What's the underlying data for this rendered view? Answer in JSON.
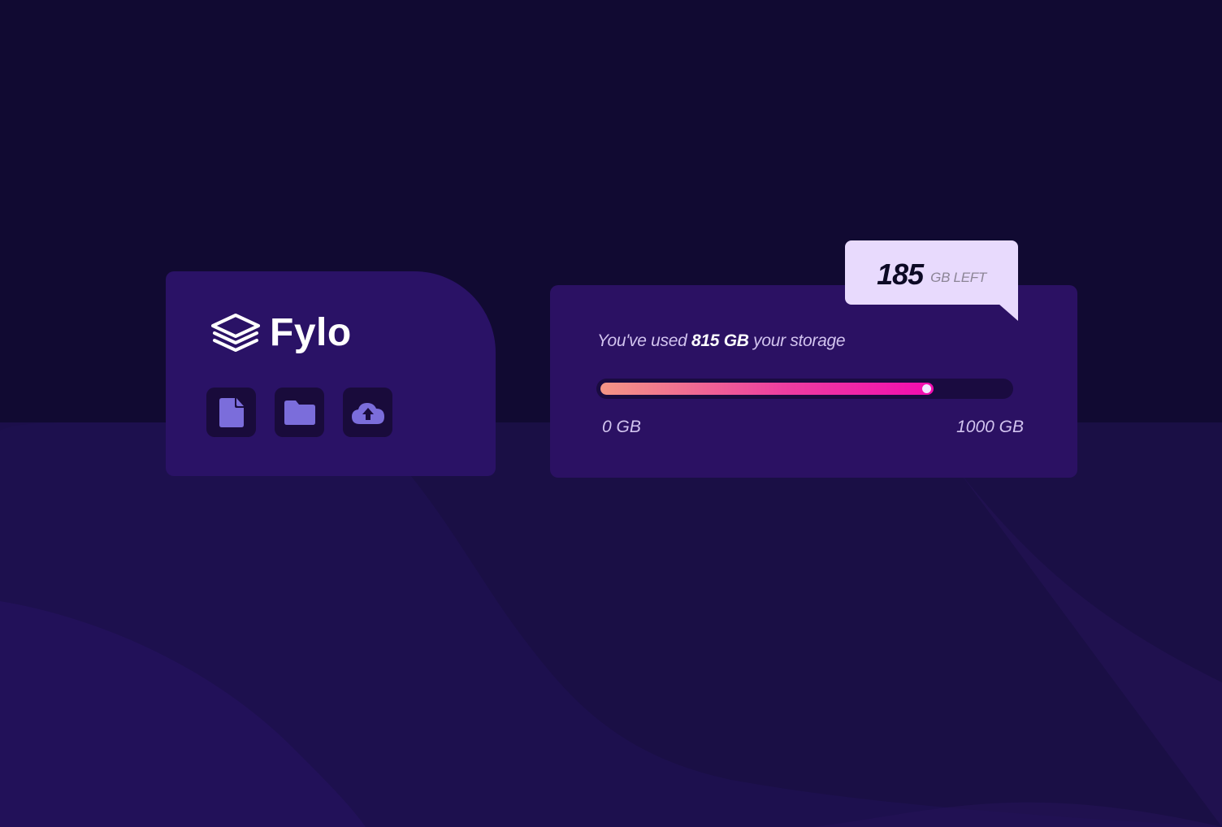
{
  "brand": {
    "name": "Fylo",
    "logo_icon": "layers-icon"
  },
  "tools": [
    {
      "name": "document",
      "icon": "document-icon"
    },
    {
      "name": "folder",
      "icon": "folder-icon"
    },
    {
      "name": "upload",
      "icon": "cloud-upload-icon"
    }
  ],
  "storage": {
    "usage_prefix": "You've used ",
    "used_amount": "815 GB",
    "usage_suffix": " your storage",
    "used_gb": 815,
    "total_gb": 1000,
    "used_fraction": 0.815,
    "min_label": "0 GB",
    "max_label": "1000 GB"
  },
  "remaining": {
    "value": "185",
    "unit": "GB LEFT"
  },
  "colors": {
    "background": "#110a32",
    "card": "#2a1266",
    "icon_accent": "#7b6ddb",
    "bubble": "#e8dafd",
    "meter_start": "#f49685",
    "meter_end": "#f20bb0"
  }
}
